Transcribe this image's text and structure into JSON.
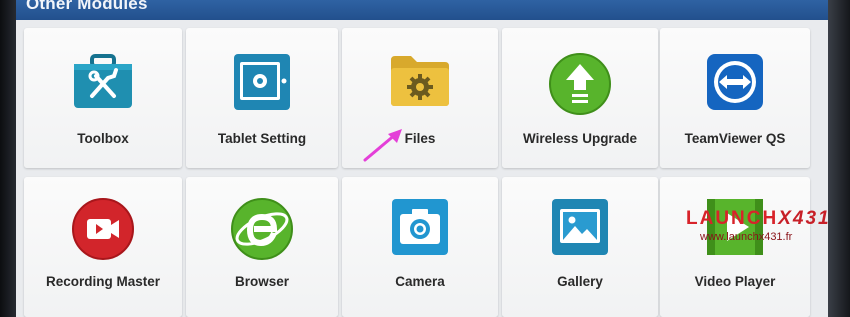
{
  "header": {
    "title": "Other Modules"
  },
  "modules_row1": [
    {
      "label": "Toolbox",
      "icon": "toolbox-icon"
    },
    {
      "label": "Tablet Setting",
      "icon": "tablet-settings-icon"
    },
    {
      "label": "Files",
      "icon": "folder-gear-icon"
    },
    {
      "label": "Wireless Upgrade",
      "icon": "upgrade-arrow-icon"
    },
    {
      "label": "TeamViewer QS",
      "icon": "teamviewer-icon"
    }
  ],
  "modules_row2": [
    {
      "label": "Recording Master",
      "icon": "video-record-icon"
    },
    {
      "label": "Browser",
      "icon": "browser-e-icon"
    },
    {
      "label": "Camera",
      "icon": "camera-icon"
    },
    {
      "label": "Gallery",
      "icon": "gallery-icon"
    },
    {
      "label": "Video Player",
      "icon": "video-play-icon"
    }
  ],
  "watermark": {
    "brand": "LAUNCH",
    "brand_suffix": "X431",
    "url": "www.launchx431.fr"
  },
  "colors": {
    "header": "#2a5a9a",
    "toolbox": "#1f8fb0",
    "files": "#e2b73a",
    "upgrade": "#58b42c",
    "teamviewer": "#1565c0",
    "recording": "#d2252b",
    "camera": "#2196d0",
    "watermark": "#d8232a",
    "arrow": "#e43fd8"
  }
}
